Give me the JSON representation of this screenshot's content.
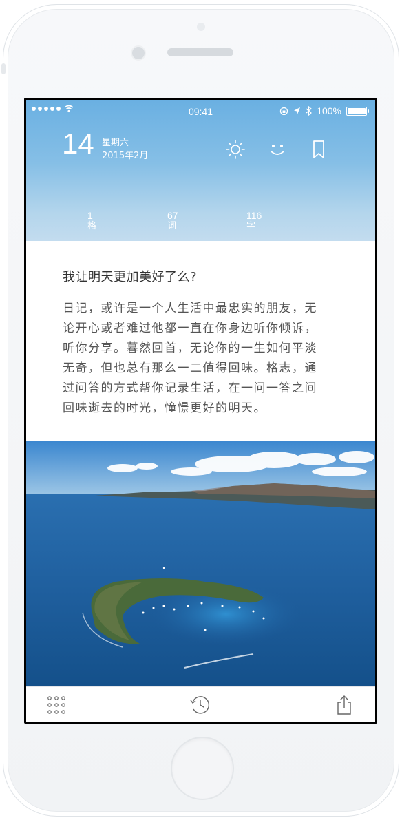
{
  "status_bar": {
    "time": "09:41",
    "battery": "100%"
  },
  "header": {
    "day": "14",
    "weekday": "星期六",
    "date": "2015年2月",
    "icons": [
      "sun-icon",
      "smile-icon",
      "bookmark-icon"
    ],
    "stats": [
      {
        "value": "1",
        "label": "格"
      },
      {
        "value": "67",
        "label": "词"
      },
      {
        "value": "116",
        "label": "字"
      }
    ]
  },
  "entry": {
    "question": "我让明天更加美好了么?",
    "body_lines": [
      "日记，或许是一个人生活中最忠实的朋友，无",
      "论开心或者难过他都一直在你身边听你倾诉，",
      "听你分享。暮然回首，无论你的一生如何平淡",
      "无奇，但也总有那么一二值得回味。格志，通",
      "过问答的方式帮你记录生活，在一问一答之间",
      "回味逝去的时光，憧憬更好的明天。"
    ]
  },
  "toolbar": {
    "icons": [
      "grid-menu-icon",
      "history-clock-icon",
      "share-icon"
    ]
  },
  "colors": {
    "header_top": "#6ab0e2",
    "header_bottom": "#c3dcef",
    "body_text": "#555555",
    "question_text": "#333333"
  }
}
